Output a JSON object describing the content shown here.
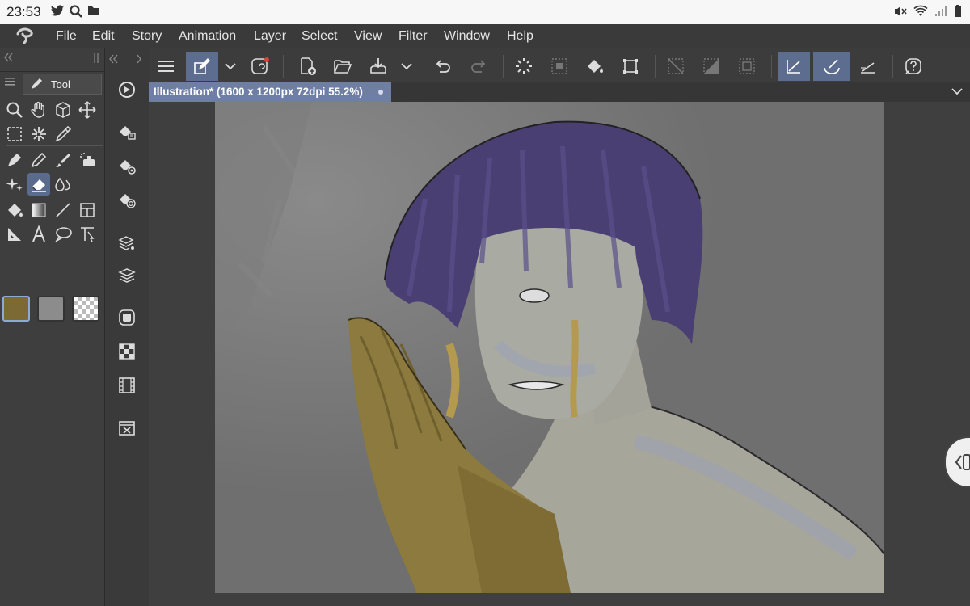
{
  "status_bar": {
    "time": "23:53",
    "left_icons": [
      "twitter-icon",
      "search-icon",
      "folder-icon"
    ],
    "right_icons": [
      "mute-icon",
      "wifi-icon",
      "signal-icon",
      "battery-icon"
    ]
  },
  "menu": {
    "items": [
      "File",
      "Edit",
      "Story",
      "Animation",
      "Layer",
      "Select",
      "View",
      "Filter",
      "Window",
      "Help"
    ]
  },
  "left_panel": {
    "tool_tab_label": "Tool",
    "main_color": "#7b6a33",
    "sub_color": "#8c8c8c"
  },
  "document": {
    "tab_title": "Illustration* (1600 x 1200px 72dpi 55.2%)"
  },
  "colors": {
    "accent": "#6f7fa3",
    "active_button": "#5d6d8f"
  }
}
